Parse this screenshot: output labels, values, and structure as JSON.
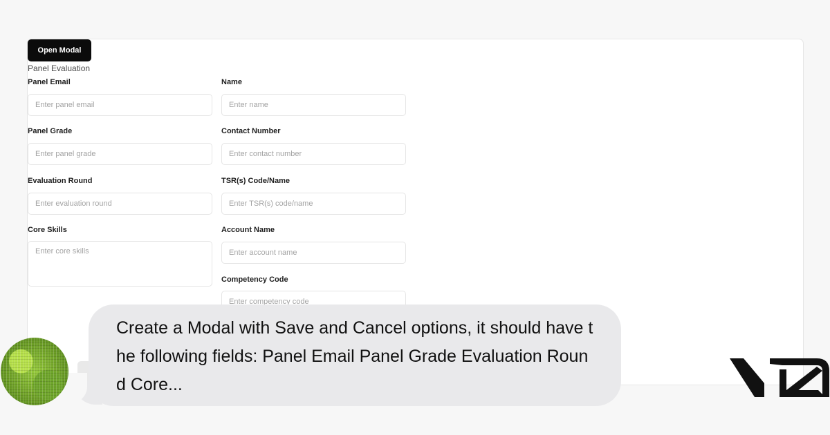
{
  "toolbar": {
    "open_modal_label": "Open Modal"
  },
  "form": {
    "title": "Panel Evaluation",
    "fields": {
      "panel_email": {
        "label": "Panel Email",
        "placeholder": "Enter panel email"
      },
      "name": {
        "label": "Name",
        "placeholder": "Enter name"
      },
      "panel_grade": {
        "label": "Panel Grade",
        "placeholder": "Enter panel grade"
      },
      "contact_number": {
        "label": "Contact Number",
        "placeholder": "Enter contact number"
      },
      "evaluation_round": {
        "label": "Evaluation Round",
        "placeholder": "Enter evaluation round"
      },
      "tsr_code_name": {
        "label": "TSR(s) Code/Name",
        "placeholder": "Enter TSR(s) code/name"
      },
      "core_skills": {
        "label": "Core Skills",
        "placeholder": "Enter core skills"
      },
      "account_name": {
        "label": "Account Name",
        "placeholder": "Enter account name"
      },
      "competency_code": {
        "label": "Competency Code",
        "placeholder": "Enter competency code"
      }
    }
  },
  "chat": {
    "message": "Create a Modal with Save and Cancel options, it should have the following fields: Panel Email Panel Grade Evaluation Round Core..."
  },
  "icons": {
    "avatar": "avatar-icon",
    "brand": "v0-logo-icon"
  },
  "colors": {
    "button_bg": "#0b0b0b",
    "bubble_bg": "#e9e9eb",
    "avatar_green": "#95c93b"
  }
}
